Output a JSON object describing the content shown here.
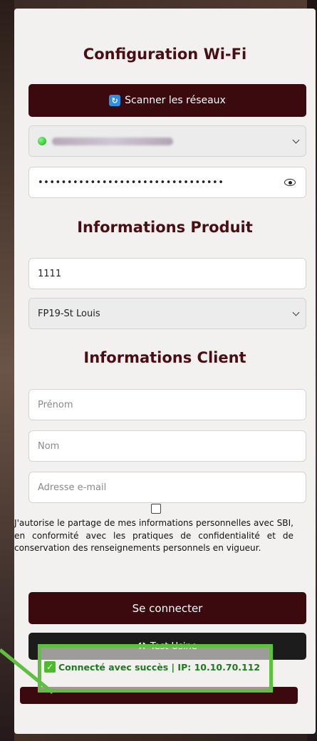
{
  "wifi": {
    "title": "Configuration Wi-Fi",
    "scan_label": "Scanner les réseaux",
    "password_masked": "••••••••••••••••••••••••••••••••"
  },
  "product": {
    "title": "Informations Produit",
    "serial_value": "1111",
    "model_selected": "FP19-St Louis"
  },
  "client": {
    "title": "Informations Client",
    "firstname_placeholder": "Prénom",
    "lastname_placeholder": "Nom",
    "email_placeholder": "Adresse e-mail",
    "consent_text": "J'autorise le partage de mes informations personnelles avec SBI, en conformité avec les pratiques de confidentialité et de conservation des renseignements personnels en vigueur."
  },
  "actions": {
    "connect_label": "Se connecter",
    "factory_test_label": "Test Usine"
  },
  "status": {
    "message": "Connecté avec succès | IP: 10.10.70.112"
  },
  "colors": {
    "brand": "#3b0a0e",
    "title": "#4a0d12",
    "success": "#1f7a1f",
    "highlight": "#5fbf3f"
  }
}
